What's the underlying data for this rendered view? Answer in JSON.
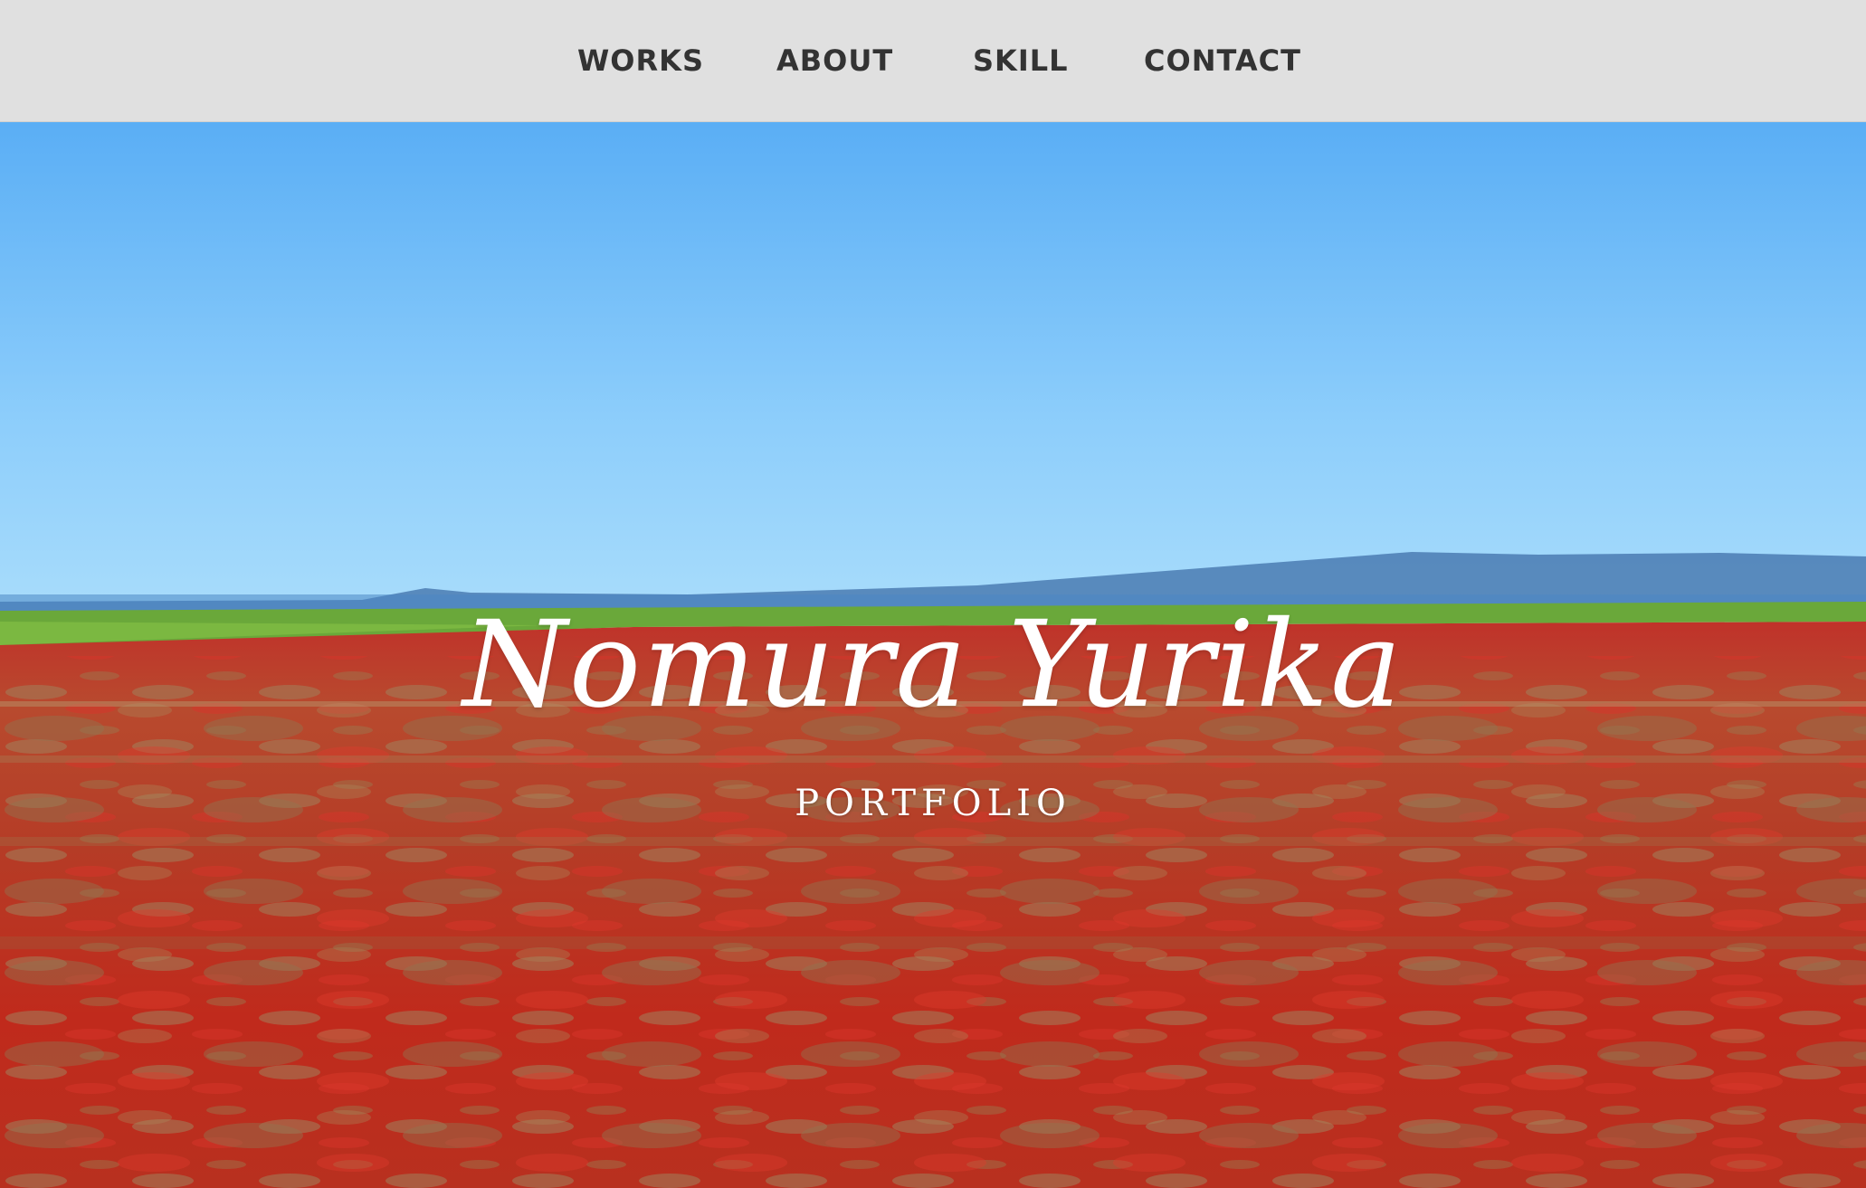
{
  "nav": {
    "items": [
      {
        "label": "WORKS"
      },
      {
        "label": "ABOUT"
      },
      {
        "label": "SKILL"
      },
      {
        "label": "CONTACT"
      }
    ]
  },
  "hero": {
    "title": "Nomura Yurika",
    "subtitle": "PORTFOLIO",
    "image": "red-seepweed-field-under-blue-sky"
  },
  "colors": {
    "nav_background": "#e0e0e0",
    "nav_text": "#333333",
    "sky_top": "#5aaef5",
    "sky_bottom": "#a8dcfb",
    "field_red": "#c8281c",
    "soil": "#a88a5c",
    "hero_text": "#ffffff"
  }
}
